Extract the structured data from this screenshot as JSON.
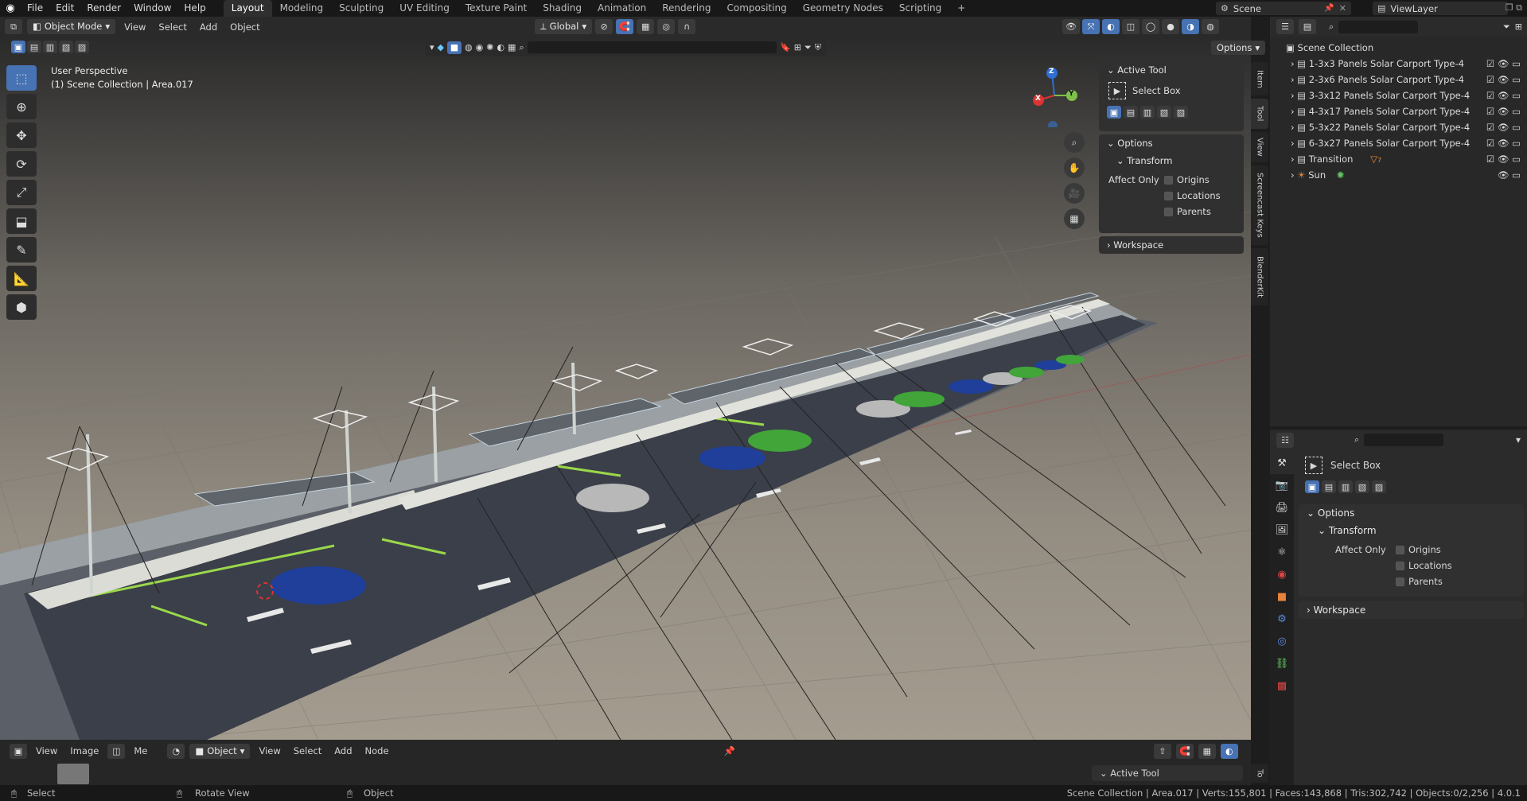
{
  "menubar": {
    "menus": [
      "File",
      "Edit",
      "Render",
      "Window",
      "Help"
    ],
    "workspaces": [
      "Layout",
      "Modeling",
      "Sculpting",
      "UV Editing",
      "Texture Paint",
      "Shading",
      "Animation",
      "Rendering",
      "Compositing",
      "Geometry Nodes",
      "Scripting"
    ],
    "active_workspace": "Layout",
    "add_tab": "+",
    "scene_label": "Scene",
    "viewlayer_label": "ViewLayer"
  },
  "viewport_header": {
    "mode": "Object Mode",
    "menus": [
      "View",
      "Select",
      "Add",
      "Object"
    ],
    "orientation": "Global",
    "options": "Options"
  },
  "viewport": {
    "perspective": "User Perspective",
    "collection_info": "(1) Scene Collection | Area.017",
    "gizmo": {
      "x": "X",
      "y": "Y",
      "z": "Z"
    }
  },
  "side_tabs": [
    "Item",
    "Tool",
    "View",
    "Screencast Keys",
    "BlenderKit"
  ],
  "tool_panel": {
    "active_tool_title": "Active Tool",
    "active_tool_name": "Select Box",
    "options_title": "Options",
    "transform_title": "Transform",
    "affect_only": "Affect Only",
    "origins": "Origins",
    "locations": "Locations",
    "parents": "Parents",
    "workspace_title": "Workspace"
  },
  "outliner": {
    "root": "Scene Collection",
    "items": [
      {
        "name": "1-3x3 Panels Solar Carport Type-4"
      },
      {
        "name": "2-3x6 Panels Solar Carport Type-4"
      },
      {
        "name": "3-3x12 Panels Solar Carport Type-4"
      },
      {
        "name": "4-3x17 Panels Solar Carport Type-4"
      },
      {
        "name": "5-3x22 Panels Solar Carport Type-4"
      },
      {
        "name": "6-3x27 Panels Solar Carport Type-4"
      },
      {
        "name": "Transition",
        "badge": "7"
      },
      {
        "name": "Sun"
      }
    ]
  },
  "properties": {
    "active_tool_name": "Select Box",
    "options_title": "Options",
    "transform_title": "Transform",
    "affect_only": "Affect Only",
    "origins": "Origins",
    "locations": "Locations",
    "parents": "Parents",
    "workspace_title": "Workspace"
  },
  "timeline_header": {
    "view": "View",
    "image": "Image",
    "me": "Me",
    "object": "Object",
    "view2": "View",
    "select": "Select",
    "add": "Add",
    "node": "Node",
    "active_tool": "Active Tool",
    "tab_to": "To"
  },
  "statusbar": {
    "select": "Select",
    "rotate": "Rotate View",
    "object": "Object",
    "stats": "Scene Collection | Area.017 | Verts:155,801 | Faces:143,868 | Tris:302,742 | Objects:0/2,256 | 4.0.1"
  },
  "colors": {
    "accent": "#4772b3",
    "ground": "#8c8478",
    "road": "#3a3f49",
    "highlight": "#9bd84a"
  }
}
